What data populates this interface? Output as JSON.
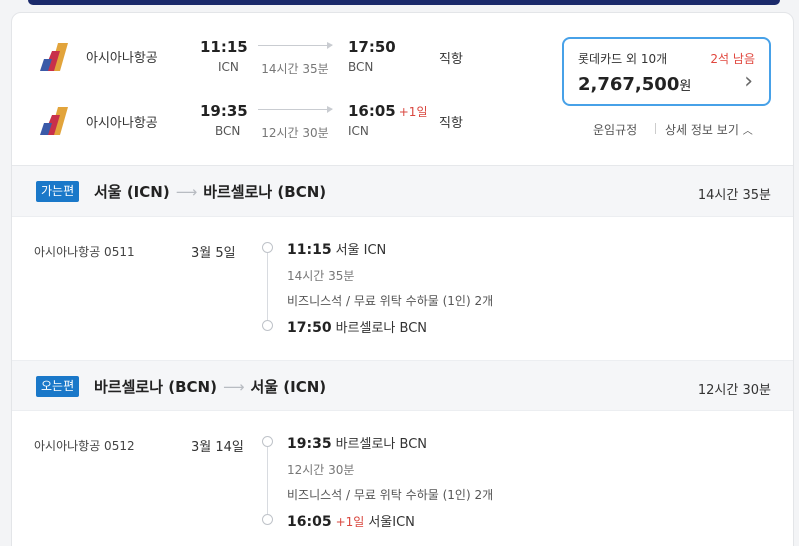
{
  "summary": {
    "outbound": {
      "airline": "아시아나항공",
      "dep_time": "11:15",
      "dep_code": "ICN",
      "duration": "14시간 35분",
      "arr_time": "17:50",
      "arr_code": "BCN",
      "type": "직항"
    },
    "inbound": {
      "airline": "아시아나항공",
      "dep_time": "19:35",
      "dep_code": "BCN",
      "duration": "12시간 30분",
      "arr_time": "16:05",
      "day_offset": "+1일",
      "arr_code": "ICN",
      "type": "직항"
    },
    "price": {
      "card": "롯데카드 외 10개",
      "seats": "2석 남음",
      "amount": "2,767,500",
      "currency": "원"
    },
    "links": {
      "fare_rules": "운임규정",
      "details": "상세 정보 보기"
    }
  },
  "legs": [
    {
      "badge": "가는편",
      "from": "서울 (ICN)",
      "to": "바르셀로나 (BCN)",
      "duration": "14시간 35분",
      "flight_no": "아시아나항공 0511",
      "date": "3월 5일",
      "dep_time": "11:15",
      "dep_place": "서울 ICN",
      "segment_duration": "14시간 35분",
      "cabin": "비즈니스석 / 무료 위탁 수하물 (1인) 2개",
      "arr_time": "17:50",
      "arr_offset": "",
      "arr_place": "바르셀로나 BCN"
    },
    {
      "badge": "오는편",
      "from": "바르셀로나 (BCN)",
      "to": "서울 (ICN)",
      "duration": "12시간 30분",
      "flight_no": "아시아나항공 0512",
      "date": "3월 14일",
      "dep_time": "19:35",
      "dep_place": "바르셀로나 BCN",
      "segment_duration": "12시간 30분",
      "cabin": "비즈니스석 / 무료 위탁 수하물 (1인) 2개",
      "arr_time": "16:05",
      "arr_offset": "+1일",
      "arr_place": "서울ICN"
    }
  ],
  "icons": {
    "logo": "asiana-logo-icon",
    "chevron": "chevron-right-icon",
    "up": "chevron-up-icon",
    "arrow": "arrow-right-icon"
  },
  "colors": {
    "accent": "#47a1e8",
    "badge": "#1a78c9",
    "warning": "#e0463d",
    "header_bar": "#1b2a6b"
  }
}
